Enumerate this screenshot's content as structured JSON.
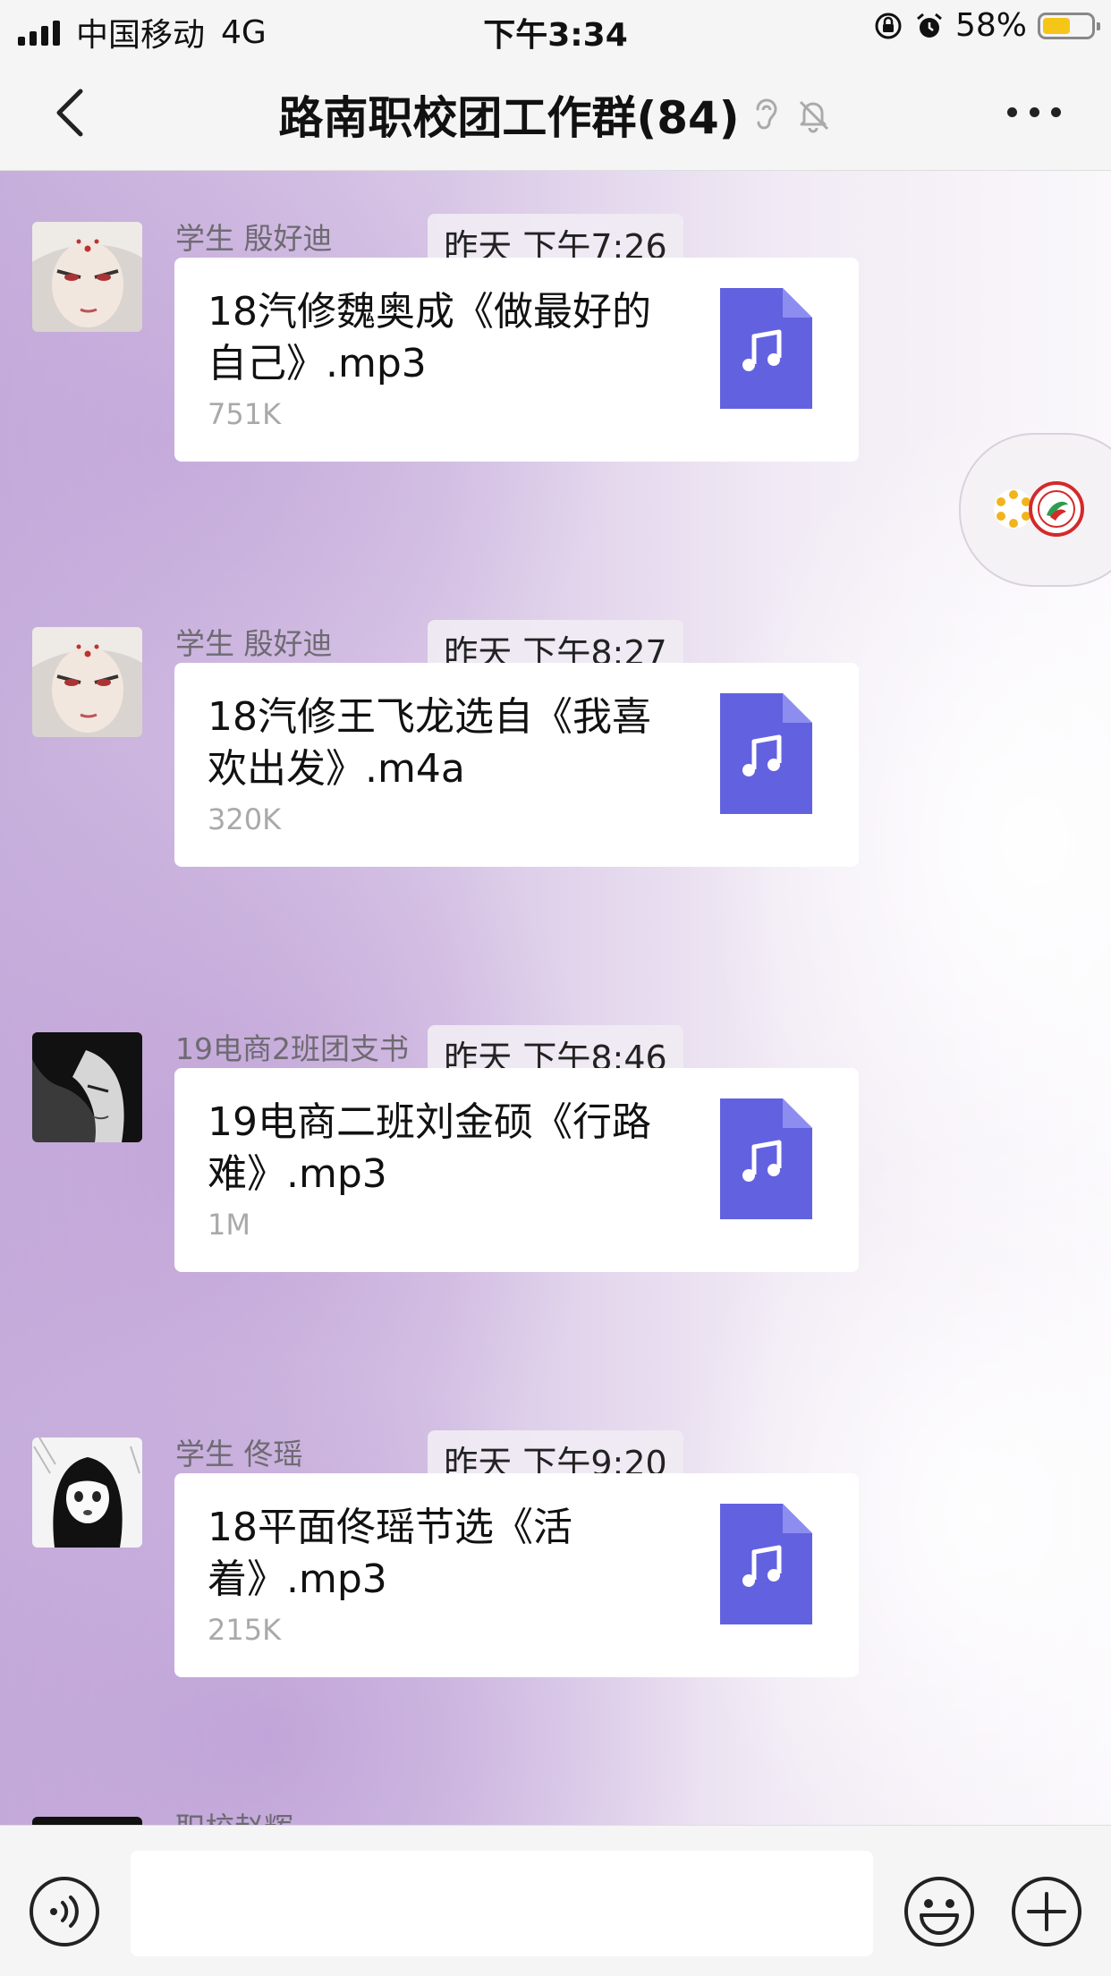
{
  "status_bar": {
    "carrier": "中国移动",
    "network": "4G",
    "time": "下午3:34",
    "battery_text": "58%",
    "battery_level": 0.58,
    "battery_color": "#f5c518"
  },
  "nav": {
    "title": "路南职校团工作群(84)",
    "icons": [
      "back-icon",
      "ear-icon",
      "bell-muted-icon",
      "more-icon"
    ]
  },
  "messages": [
    {
      "timestamp": "昨天 下午7:26",
      "sender": "学生 殷好迪",
      "file_name": "18汽修魏奥成《做最好的自己》.mp3",
      "file_size": "751K"
    },
    {
      "timestamp": "昨天 下午8:27",
      "sender": "学生 殷好迪",
      "file_name": "18汽修王飞龙选自《我喜欢出发》.m4a",
      "file_size": "320K"
    },
    {
      "timestamp": "昨天 下午8:46",
      "sender": "19电商2班团支书",
      "file_name": "19电商二班刘金硕《行路难》.mp3",
      "file_size": "1M"
    },
    {
      "timestamp": "昨天 下午9:20",
      "sender": "学生 佟瑶",
      "file_name": "18平面佟瑶节选《活着》.mp3",
      "file_size": "215K"
    }
  ],
  "partial_sender": "职校赵辉",
  "file_icon_color": "#6262e0",
  "input": {
    "value": "",
    "icons": [
      "voice-icon",
      "emoji-icon",
      "plus-icon"
    ]
  }
}
